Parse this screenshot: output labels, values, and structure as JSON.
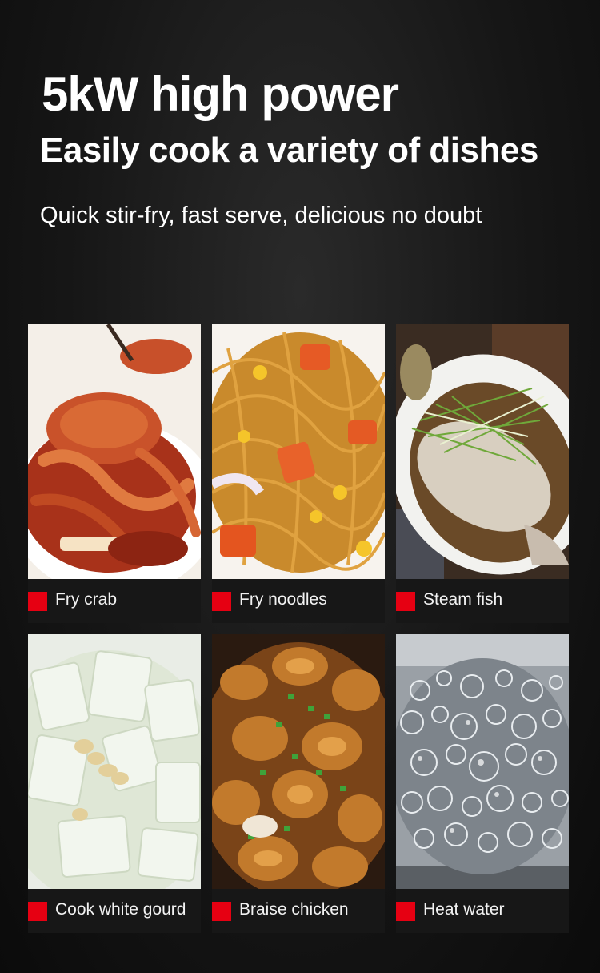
{
  "header": {
    "title": "5kW high power",
    "subtitle": "Easily cook a variety of dishes",
    "tagline": "Quick stir-fry, fast serve, delicious no doubt"
  },
  "dishes": [
    {
      "label": "Fry crab",
      "icon": "crab-photo"
    },
    {
      "label": "Fry noodles",
      "icon": "noodles-photo"
    },
    {
      "label": "Steam fish",
      "icon": "fish-photo"
    },
    {
      "label": "Cook white gourd",
      "icon": "white-gourd-photo"
    },
    {
      "label": "Braise chicken",
      "icon": "chicken-photo"
    },
    {
      "label": "Heat water",
      "icon": "boiling-water-photo"
    }
  ],
  "colors": {
    "accent": "#e60012",
    "background": "#111111",
    "caption_bar": "#171717",
    "text": "#ffffff"
  }
}
